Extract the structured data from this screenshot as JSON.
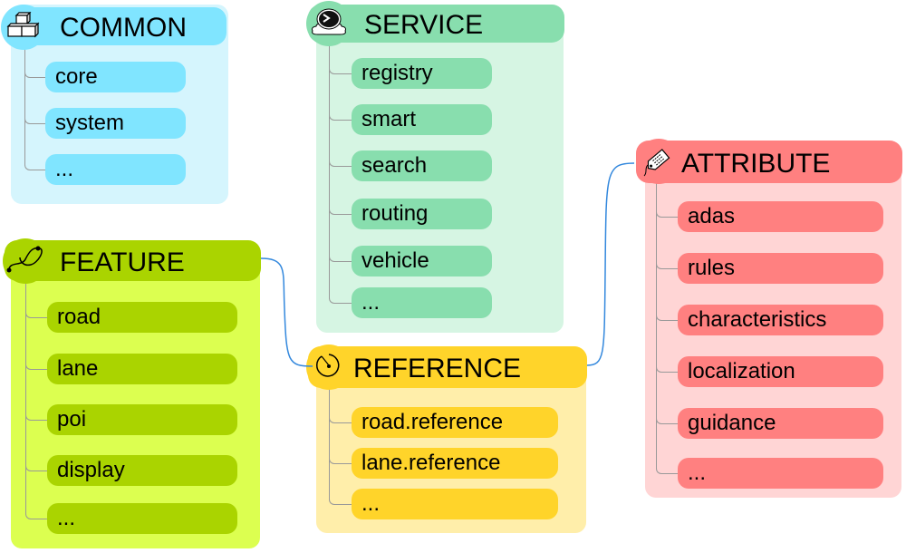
{
  "groups": [
    {
      "id": "common",
      "title": "COMMON",
      "icon": "blocks-icon",
      "header_color": "#80e5ff",
      "panel_color": "#d5f5fd",
      "items": [
        "core",
        "system",
        "..."
      ]
    },
    {
      "id": "service",
      "title": "SERVICE",
      "icon": "terminal-cloud-icon",
      "header_color": "#88deae",
      "panel_color": "#d6f5e3",
      "items": [
        "registry",
        "smart",
        "search",
        "routing",
        "vehicle",
        "..."
      ]
    },
    {
      "id": "feature",
      "title": "FEATURE",
      "icon": "curve-path-icon",
      "header_color": "#aad400",
      "panel_color": "#dcff50",
      "items": [
        "road",
        "lane",
        "poi",
        "display",
        "..."
      ]
    },
    {
      "id": "reference",
      "title": "REFERENCE",
      "icon": "circular-arrow-icon",
      "header_color": "#ffd42a",
      "panel_color": "#ffeeaa",
      "items": [
        "road.reference",
        "lane.reference",
        "..."
      ]
    },
    {
      "id": "attribute",
      "title": "ATTRIBUTE",
      "icon": "tag-icon",
      "header_color": "#ff8080",
      "panel_color": "#ffd5d5",
      "items": [
        "adas",
        "rules",
        "characteristics",
        "localization",
        "guidance",
        "..."
      ]
    }
  ],
  "connections": [
    {
      "from": "feature",
      "to": "reference"
    },
    {
      "from": "reference",
      "to": "attribute"
    }
  ],
  "connector_color": "#3388dd"
}
